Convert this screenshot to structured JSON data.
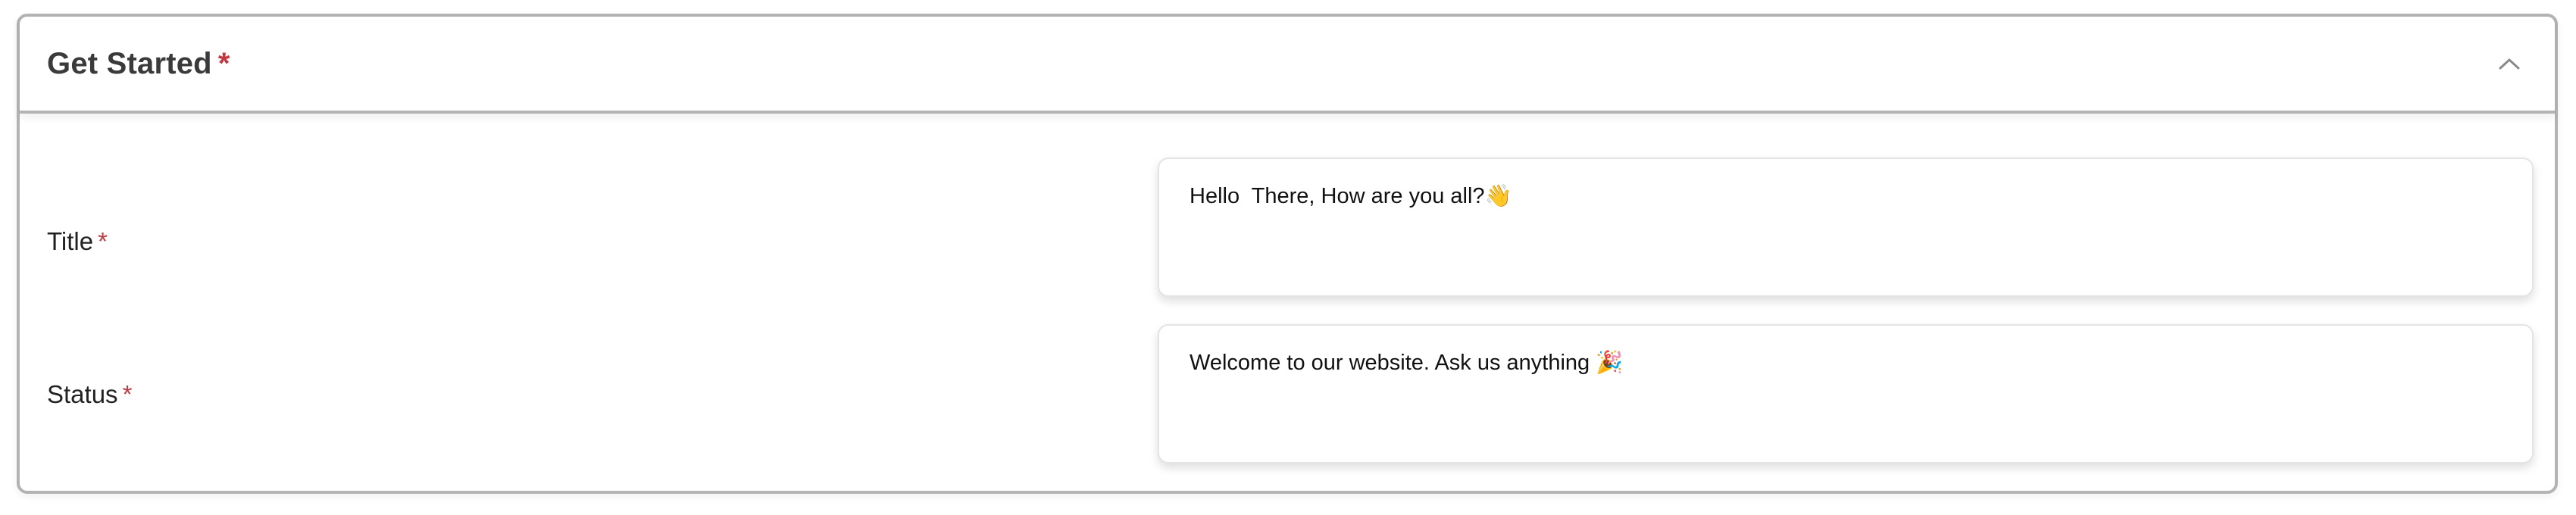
{
  "section": {
    "title": "Get Started",
    "required_mark": "*",
    "collapse_icon": "chevron-up-icon"
  },
  "fields": {
    "title": {
      "label": "Title",
      "required_mark": "*",
      "value": "Hello  There, How are you all?👋"
    },
    "status": {
      "label": "Status",
      "required_mark": "*",
      "value": "Welcome to our website. Ask us anything 🎉"
    }
  },
  "colors": {
    "required": "#c4373d",
    "border": "#b3b3b3",
    "title_text": "#3a3a3a"
  }
}
